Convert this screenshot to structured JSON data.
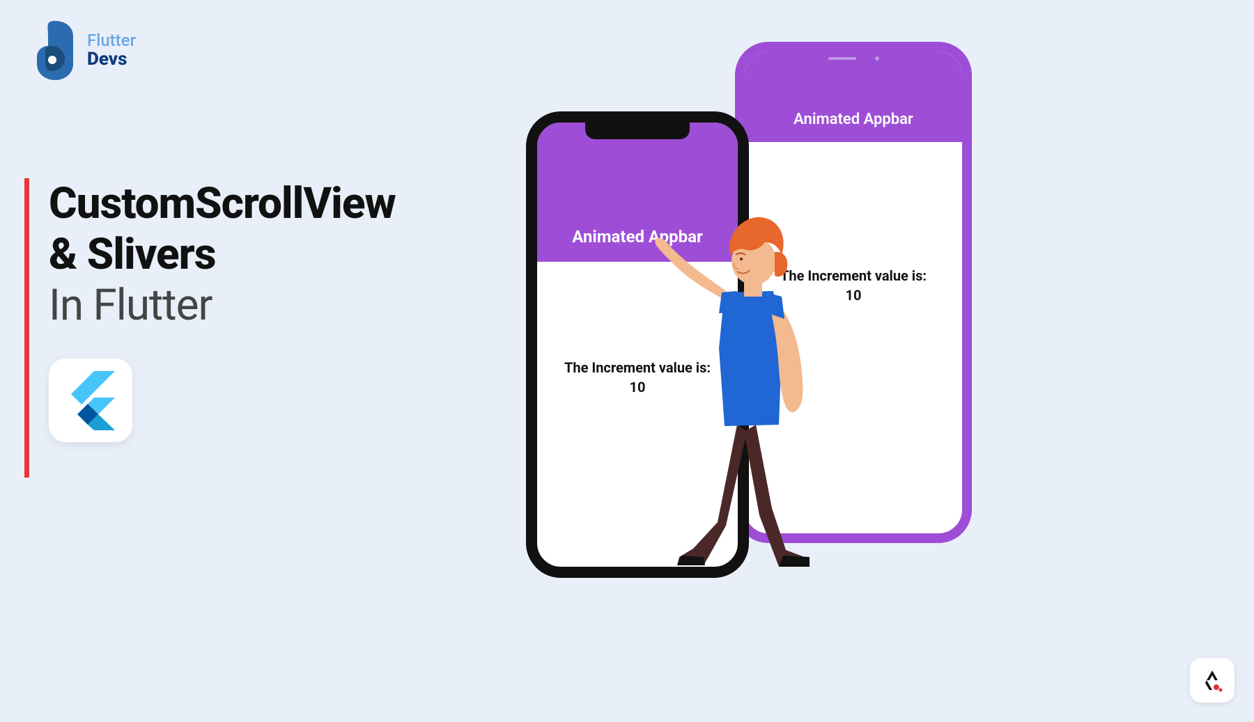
{
  "logo": {
    "text_top": "Flutter",
    "text_bottom": "Devs"
  },
  "title": {
    "line1": "CustomScrollView",
    "line2": "& Slivers",
    "line3": "In Flutter"
  },
  "phone_back": {
    "appbar_title": "Animated Appbar",
    "increment_label": "The Increment value is:",
    "increment_value": "10"
  },
  "phone_front": {
    "appbar_title": "Animated Appbar",
    "increment_label": "The Increment value is:",
    "increment_value": "10"
  },
  "colors": {
    "background": "#e9eff9",
    "accent_purple": "#9e4ed6",
    "accent_red": "#e83737"
  }
}
